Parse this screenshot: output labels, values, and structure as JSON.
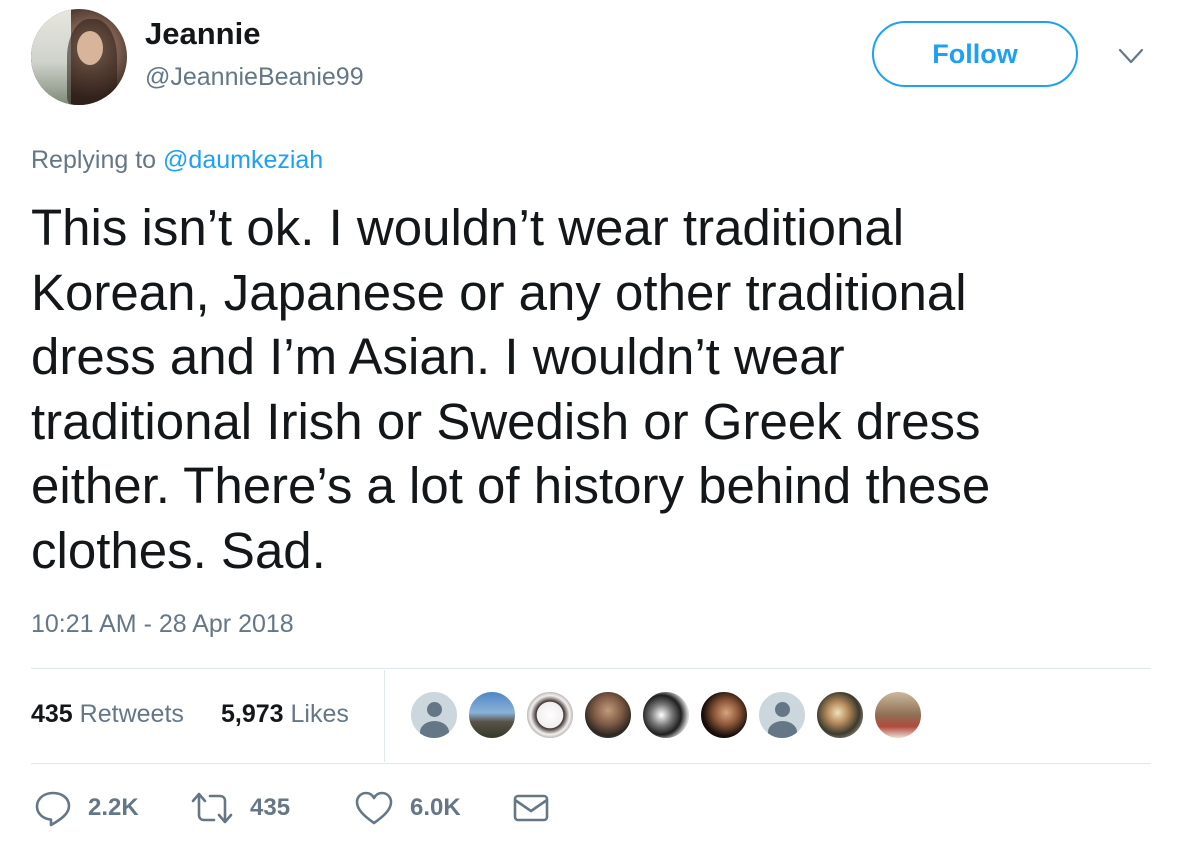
{
  "author": {
    "display_name": "Jeannie",
    "handle": "@JeannieBeanie99"
  },
  "header": {
    "follow_label": "Follow",
    "more_icon": "chevron-down-icon"
  },
  "reply": {
    "prefix": "Replying to ",
    "mention": "@daumkeziah"
  },
  "tweet": {
    "text": "This isn’t ok. I wouldn’t wear traditional\nKorean, Japanese or any other traditional\ndress and I’m Asian. I wouldn’t wear\ntraditional Irish or Swedish or Greek dress\neither. There’s a lot of history behind these\nclothes. Sad.",
    "timestamp": "10:21 AM - 28 Apr 2018"
  },
  "stats": {
    "retweets_count": "435",
    "retweets_label": "Retweets",
    "likes_count": "5,973",
    "likes_label": "Likes"
  },
  "likers": [
    {
      "icon": "default-profile-icon"
    },
    {
      "icon": "profile-photo"
    },
    {
      "icon": "profile-photo"
    },
    {
      "icon": "profile-photo"
    },
    {
      "icon": "profile-photo"
    },
    {
      "icon": "profile-photo"
    },
    {
      "icon": "default-profile-icon"
    },
    {
      "icon": "profile-photo"
    },
    {
      "icon": "profile-photo"
    }
  ],
  "actions": {
    "reply_count": "2.2K",
    "retweet_count": "435",
    "like_count": "6.0K",
    "reply_icon": "reply-icon",
    "retweet_icon": "retweet-icon",
    "like_icon": "heart-icon",
    "dm_icon": "envelope-icon"
  },
  "colors": {
    "accent": "#1da1f2",
    "text": "#14171a",
    "secondary_text": "#657786",
    "divider": "#e1e8ed"
  }
}
